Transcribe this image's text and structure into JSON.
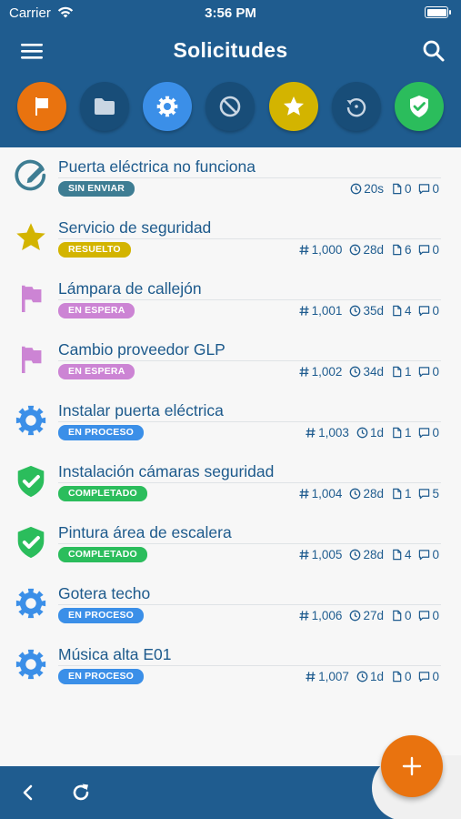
{
  "status_bar": {
    "carrier": "Carrier",
    "time": "3:56 PM"
  },
  "header": {
    "title": "Solicitudes"
  },
  "filters": [
    {
      "name": "flag",
      "color": "#e9730f"
    },
    {
      "name": "folder",
      "color": "#184d78"
    },
    {
      "name": "gear",
      "color": "#3b8fe8"
    },
    {
      "name": "cancel",
      "color": "#184d78"
    },
    {
      "name": "star",
      "color": "#d3b400"
    },
    {
      "name": "history",
      "color": "#184d78"
    },
    {
      "name": "shield",
      "color": "#2bbd5c"
    }
  ],
  "status_colors": {
    "draft": "#3e7d93",
    "resolved": "#d3b400",
    "waiting": "#cc84d4",
    "in_progress": "#3b8fe8",
    "completed": "#2bbd5c"
  },
  "items": [
    {
      "title": "Puerta eléctrica no funciona",
      "status": "SIN ENVIAR",
      "status_key": "draft",
      "icon": "edit-icon",
      "number": "",
      "time": "20s",
      "files": "0",
      "comments": "0"
    },
    {
      "title": "Servicio de seguridad",
      "status": "RESUELTO",
      "status_key": "resolved",
      "icon": "star-icon",
      "number": "1,000",
      "time": "28d",
      "files": "6",
      "comments": "0"
    },
    {
      "title": "Lámpara de callejón",
      "status": "EN ESPERA",
      "status_key": "waiting",
      "icon": "flag-icon",
      "number": "1,001",
      "time": "35d",
      "files": "4",
      "comments": "0"
    },
    {
      "title": "Cambio proveedor GLP",
      "status": "EN ESPERA",
      "status_key": "waiting",
      "icon": "flag-icon",
      "number": "1,002",
      "time": "34d",
      "files": "1",
      "comments": "0"
    },
    {
      "title": "Instalar puerta eléctrica",
      "status": "EN PROCESO",
      "status_key": "in_progress",
      "icon": "gear-icon",
      "number": "1,003",
      "time": "1d",
      "files": "1",
      "comments": "0"
    },
    {
      "title": "Instalación cámaras seguridad",
      "status": "COMPLETADO",
      "status_key": "completed",
      "icon": "shield-check-icon",
      "number": "1,004",
      "time": "28d",
      "files": "1",
      "comments": "5"
    },
    {
      "title": "Pintura área de escalera",
      "status": "COMPLETADO",
      "status_key": "completed",
      "icon": "shield-check-icon",
      "number": "1,005",
      "time": "28d",
      "files": "4",
      "comments": "0"
    },
    {
      "title": "Gotera techo",
      "status": "EN PROCESO",
      "status_key": "in_progress",
      "icon": "gear-icon",
      "number": "1,006",
      "time": "27d",
      "files": "0",
      "comments": "0"
    },
    {
      "title": "Música alta E01",
      "status": "EN PROCESO",
      "status_key": "in_progress",
      "icon": "gear-icon",
      "number": "1,007",
      "time": "1d",
      "files": "0",
      "comments": "0"
    }
  ]
}
